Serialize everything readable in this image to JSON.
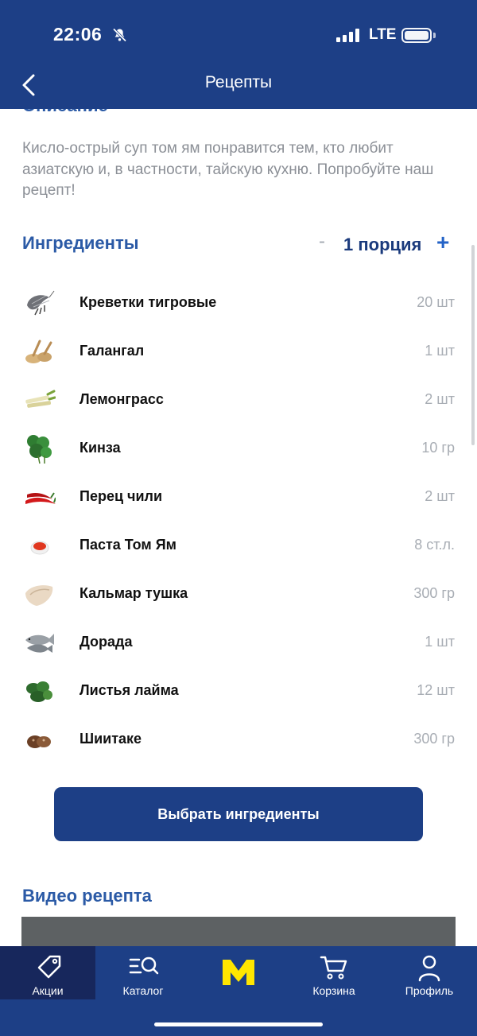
{
  "status_bar": {
    "time": "22:06",
    "network": "LTE"
  },
  "nav": {
    "title": "Рецепты"
  },
  "description": {
    "section_title": "Описание",
    "text": "Кисло-острый суп том ям понравится тем, кто любит азиатскую и, в частности, тайскую кухню. Попробуйте наш рецепт!"
  },
  "ingredients": {
    "title": "Ингредиенты",
    "minus": "-",
    "portion": "1 порция",
    "plus": "+",
    "items": [
      {
        "name": "Креветки тигровые",
        "qty": "20 шт",
        "icon": "shrimp-icon"
      },
      {
        "name": "Галангал",
        "qty": "1 шт",
        "icon": "galangal-icon"
      },
      {
        "name": "Лемонграсс",
        "qty": "2 шт",
        "icon": "lemongrass-icon"
      },
      {
        "name": "Кинза",
        "qty": "10 гр",
        "icon": "cilantro-icon"
      },
      {
        "name": "Перец чили",
        "qty": "2 шт",
        "icon": "chili-icon"
      },
      {
        "name": "Паста Том Ям",
        "qty": "8 ст.л.",
        "icon": "paste-icon"
      },
      {
        "name": "Кальмар тушка",
        "qty": "300 гр",
        "icon": "squid-icon"
      },
      {
        "name": "Дорада",
        "qty": "1 шт",
        "icon": "fish-icon"
      },
      {
        "name": "Листья лайма",
        "qty": "12 шт",
        "icon": "lime-leaves-icon"
      },
      {
        "name": "Шиитаке",
        "qty": "300 гр",
        "icon": "mushroom-icon"
      }
    ],
    "select_button": "Выбрать ингредиенты"
  },
  "video": {
    "title": "Видео рецепта"
  },
  "tabbar": {
    "items": [
      {
        "label": "Акции",
        "icon": "tag-icon",
        "active": true
      },
      {
        "label": "Каталог",
        "icon": "catalog-search-icon",
        "active": false
      },
      {
        "label": "",
        "icon": "metro-logo-icon",
        "active": false
      },
      {
        "label": "Корзина",
        "icon": "cart-icon",
        "active": false
      },
      {
        "label": "Профиль",
        "icon": "profile-icon",
        "active": false
      }
    ]
  },
  "colors": {
    "brand": "#1d3f86",
    "accent_text": "#2b5aa6",
    "logo_yellow": "#ffe600",
    "muted_text": "#8b8f96"
  }
}
